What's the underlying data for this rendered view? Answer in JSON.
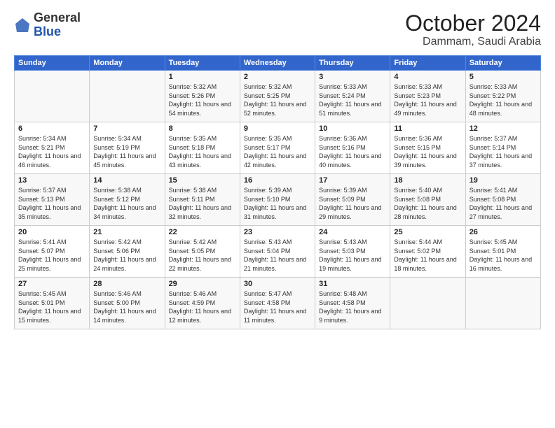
{
  "logo": {
    "general": "General",
    "blue": "Blue"
  },
  "title": "October 2024",
  "location": "Dammam, Saudi Arabia",
  "days_of_week": [
    "Sunday",
    "Monday",
    "Tuesday",
    "Wednesday",
    "Thursday",
    "Friday",
    "Saturday"
  ],
  "weeks": [
    [
      {
        "day": "",
        "sunrise": "",
        "sunset": "",
        "daylight": ""
      },
      {
        "day": "",
        "sunrise": "",
        "sunset": "",
        "daylight": ""
      },
      {
        "day": "1",
        "sunrise": "Sunrise: 5:32 AM",
        "sunset": "Sunset: 5:26 PM",
        "daylight": "Daylight: 11 hours and 54 minutes."
      },
      {
        "day": "2",
        "sunrise": "Sunrise: 5:32 AM",
        "sunset": "Sunset: 5:25 PM",
        "daylight": "Daylight: 11 hours and 52 minutes."
      },
      {
        "day": "3",
        "sunrise": "Sunrise: 5:33 AM",
        "sunset": "Sunset: 5:24 PM",
        "daylight": "Daylight: 11 hours and 51 minutes."
      },
      {
        "day": "4",
        "sunrise": "Sunrise: 5:33 AM",
        "sunset": "Sunset: 5:23 PM",
        "daylight": "Daylight: 11 hours and 49 minutes."
      },
      {
        "day": "5",
        "sunrise": "Sunrise: 5:33 AM",
        "sunset": "Sunset: 5:22 PM",
        "daylight": "Daylight: 11 hours and 48 minutes."
      }
    ],
    [
      {
        "day": "6",
        "sunrise": "Sunrise: 5:34 AM",
        "sunset": "Sunset: 5:21 PM",
        "daylight": "Daylight: 11 hours and 46 minutes."
      },
      {
        "day": "7",
        "sunrise": "Sunrise: 5:34 AM",
        "sunset": "Sunset: 5:19 PM",
        "daylight": "Daylight: 11 hours and 45 minutes."
      },
      {
        "day": "8",
        "sunrise": "Sunrise: 5:35 AM",
        "sunset": "Sunset: 5:18 PM",
        "daylight": "Daylight: 11 hours and 43 minutes."
      },
      {
        "day": "9",
        "sunrise": "Sunrise: 5:35 AM",
        "sunset": "Sunset: 5:17 PM",
        "daylight": "Daylight: 11 hours and 42 minutes."
      },
      {
        "day": "10",
        "sunrise": "Sunrise: 5:36 AM",
        "sunset": "Sunset: 5:16 PM",
        "daylight": "Daylight: 11 hours and 40 minutes."
      },
      {
        "day": "11",
        "sunrise": "Sunrise: 5:36 AM",
        "sunset": "Sunset: 5:15 PM",
        "daylight": "Daylight: 11 hours and 39 minutes."
      },
      {
        "day": "12",
        "sunrise": "Sunrise: 5:37 AM",
        "sunset": "Sunset: 5:14 PM",
        "daylight": "Daylight: 11 hours and 37 minutes."
      }
    ],
    [
      {
        "day": "13",
        "sunrise": "Sunrise: 5:37 AM",
        "sunset": "Sunset: 5:13 PM",
        "daylight": "Daylight: 11 hours and 35 minutes."
      },
      {
        "day": "14",
        "sunrise": "Sunrise: 5:38 AM",
        "sunset": "Sunset: 5:12 PM",
        "daylight": "Daylight: 11 hours and 34 minutes."
      },
      {
        "day": "15",
        "sunrise": "Sunrise: 5:38 AM",
        "sunset": "Sunset: 5:11 PM",
        "daylight": "Daylight: 11 hours and 32 minutes."
      },
      {
        "day": "16",
        "sunrise": "Sunrise: 5:39 AM",
        "sunset": "Sunset: 5:10 PM",
        "daylight": "Daylight: 11 hours and 31 minutes."
      },
      {
        "day": "17",
        "sunrise": "Sunrise: 5:39 AM",
        "sunset": "Sunset: 5:09 PM",
        "daylight": "Daylight: 11 hours and 29 minutes."
      },
      {
        "day": "18",
        "sunrise": "Sunrise: 5:40 AM",
        "sunset": "Sunset: 5:08 PM",
        "daylight": "Daylight: 11 hours and 28 minutes."
      },
      {
        "day": "19",
        "sunrise": "Sunrise: 5:41 AM",
        "sunset": "Sunset: 5:08 PM",
        "daylight": "Daylight: 11 hours and 27 minutes."
      }
    ],
    [
      {
        "day": "20",
        "sunrise": "Sunrise: 5:41 AM",
        "sunset": "Sunset: 5:07 PM",
        "daylight": "Daylight: 11 hours and 25 minutes."
      },
      {
        "day": "21",
        "sunrise": "Sunrise: 5:42 AM",
        "sunset": "Sunset: 5:06 PM",
        "daylight": "Daylight: 11 hours and 24 minutes."
      },
      {
        "day": "22",
        "sunrise": "Sunrise: 5:42 AM",
        "sunset": "Sunset: 5:05 PM",
        "daylight": "Daylight: 11 hours and 22 minutes."
      },
      {
        "day": "23",
        "sunrise": "Sunrise: 5:43 AM",
        "sunset": "Sunset: 5:04 PM",
        "daylight": "Daylight: 11 hours and 21 minutes."
      },
      {
        "day": "24",
        "sunrise": "Sunrise: 5:43 AM",
        "sunset": "Sunset: 5:03 PM",
        "daylight": "Daylight: 11 hours and 19 minutes."
      },
      {
        "day": "25",
        "sunrise": "Sunrise: 5:44 AM",
        "sunset": "Sunset: 5:02 PM",
        "daylight": "Daylight: 11 hours and 18 minutes."
      },
      {
        "day": "26",
        "sunrise": "Sunrise: 5:45 AM",
        "sunset": "Sunset: 5:01 PM",
        "daylight": "Daylight: 11 hours and 16 minutes."
      }
    ],
    [
      {
        "day": "27",
        "sunrise": "Sunrise: 5:45 AM",
        "sunset": "Sunset: 5:01 PM",
        "daylight": "Daylight: 11 hours and 15 minutes."
      },
      {
        "day": "28",
        "sunrise": "Sunrise: 5:46 AM",
        "sunset": "Sunset: 5:00 PM",
        "daylight": "Daylight: 11 hours and 14 minutes."
      },
      {
        "day": "29",
        "sunrise": "Sunrise: 5:46 AM",
        "sunset": "Sunset: 4:59 PM",
        "daylight": "Daylight: 11 hours and 12 minutes."
      },
      {
        "day": "30",
        "sunrise": "Sunrise: 5:47 AM",
        "sunset": "Sunset: 4:58 PM",
        "daylight": "Daylight: 11 hours and 11 minutes."
      },
      {
        "day": "31",
        "sunrise": "Sunrise: 5:48 AM",
        "sunset": "Sunset: 4:58 PM",
        "daylight": "Daylight: 11 hours and 9 minutes."
      },
      {
        "day": "",
        "sunrise": "",
        "sunset": "",
        "daylight": ""
      },
      {
        "day": "",
        "sunrise": "",
        "sunset": "",
        "daylight": ""
      }
    ]
  ]
}
